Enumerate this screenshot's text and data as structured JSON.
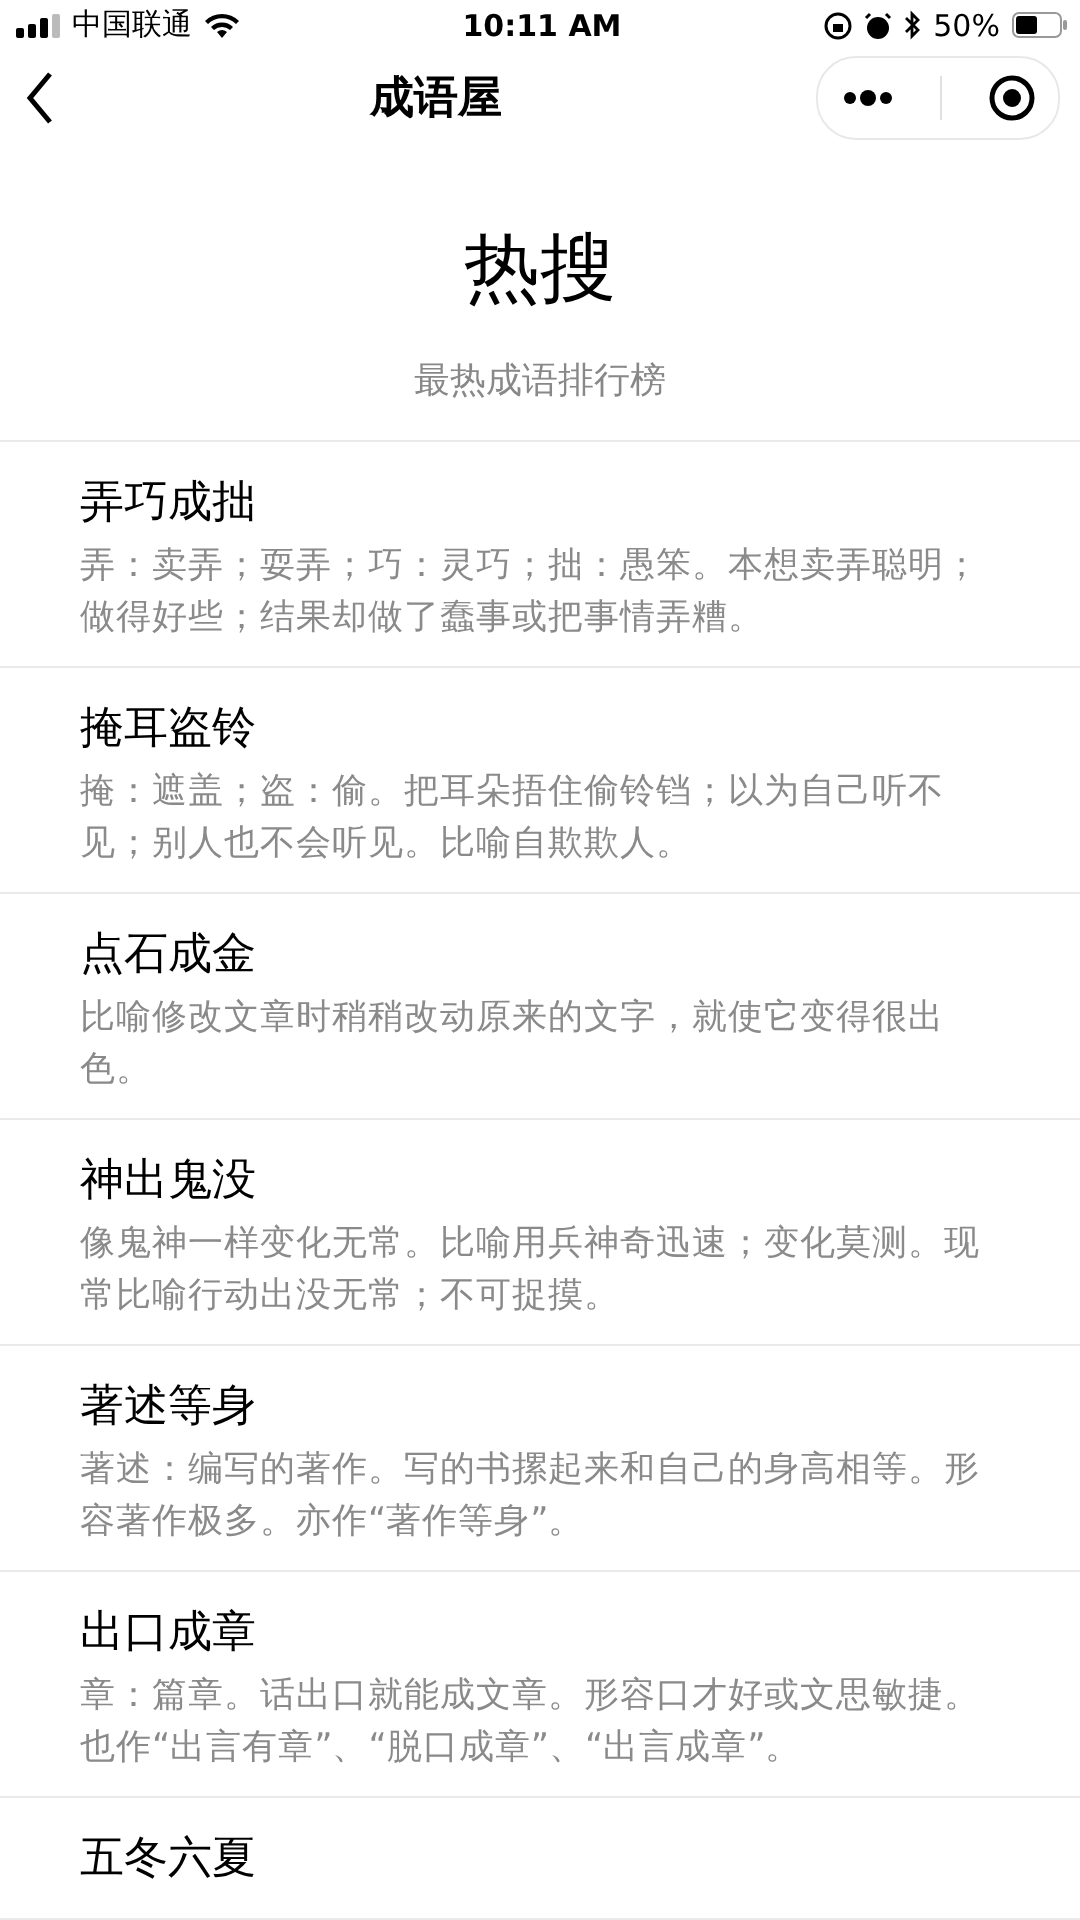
{
  "status_bar": {
    "carrier": "中国联通",
    "time": "10:11 AM",
    "battery": "50%",
    "battery_icon": {
      "level": 0.5
    }
  },
  "nav_bar": {
    "title": "成语屋"
  },
  "header": {
    "title": "热搜",
    "subtitle": "最热成语排行榜"
  },
  "idioms": [
    {
      "title": "弄巧成拙",
      "meaning": "弄：卖弄；耍弄；巧：灵巧；拙：愚笨。本想卖弄聪明；做得好些；结果却做了蠢事或把事情弄糟。"
    },
    {
      "title": "掩耳盗铃",
      "meaning": "掩：遮盖；盗：偷。把耳朵捂住偷铃铛；以为自己听不见；别人也不会听见。比喻自欺欺人。"
    },
    {
      "title": "点石成金",
      "meaning": "比喻修改文章时稍稍改动原来的文字，就使它变得很出色。"
    },
    {
      "title": "神出鬼没",
      "meaning": "像鬼神一样变化无常。比喻用兵神奇迅速；变化莫测。现常比喻行动出没无常；不可捉摸。"
    },
    {
      "title": "著述等身",
      "meaning": "著述：编写的著作。写的书摞起来和自己的身高相等。形容著作极多。亦作“著作等身”。"
    },
    {
      "title": "出口成章",
      "meaning": "章：篇章。话出口就能成文章。形容口才好或文思敏捷。也作“出言有章”、“脱口成章”、“出言成章”。"
    },
    {
      "title": "五冬六夏"
    }
  ]
}
